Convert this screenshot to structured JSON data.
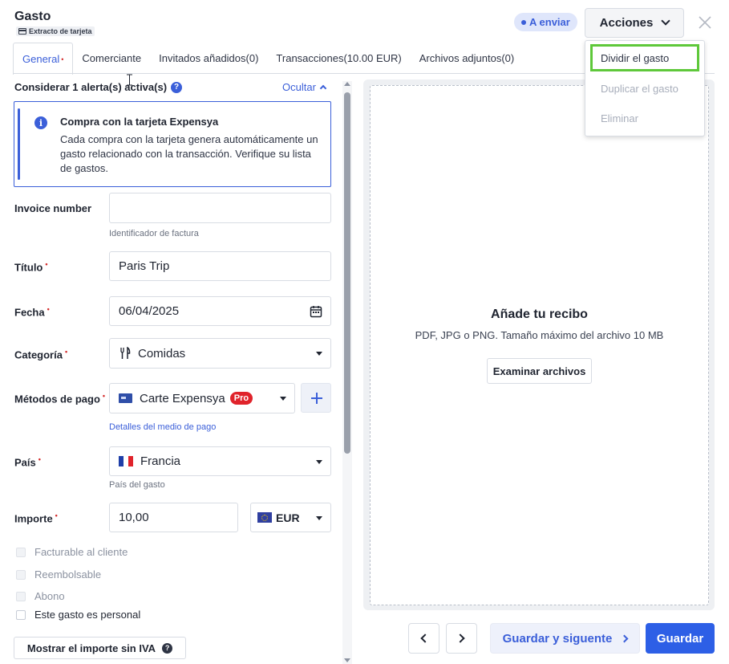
{
  "header": {
    "title": "Gasto",
    "subtitle": "Extracto de tarjeta",
    "status": "A enviar",
    "actions_label": "Acciones"
  },
  "actions_menu": {
    "items": [
      {
        "label": "Dividir el gasto",
        "enabled": true
      },
      {
        "label": "Duplicar el gasto",
        "enabled": false
      },
      {
        "label": "Eliminar",
        "enabled": false
      }
    ]
  },
  "tabs": [
    {
      "label": "General",
      "required": "•",
      "active": true
    },
    {
      "label": "Comerciante"
    },
    {
      "label": "Invitados añadidos(0)"
    },
    {
      "label": "Transacciones(10.00 EUR)"
    },
    {
      "label": "Archivos adjuntos(0)"
    }
  ],
  "alerts": {
    "heading": "Considerar 1 alerta(s) activa(s)",
    "help": "?",
    "hide_label": "Ocultar",
    "box": {
      "icon": "i",
      "title": "Compra con la tarjeta Expensya",
      "text": "Cada compra con la tarjeta genera automáticamente un gasto relacionado con la transacción. Verifique su lista de gastos."
    }
  },
  "form": {
    "required_marker": "•",
    "invoice": {
      "label": "Invoice number",
      "value": "",
      "hint": "Identificador de factura"
    },
    "title": {
      "label": "Título",
      "value": "Paris Trip"
    },
    "date": {
      "label": "Fecha",
      "value": "06/04/2025"
    },
    "category": {
      "label": "Categoría",
      "value": "Comidas",
      "icon": "cutlery-icon"
    },
    "payment": {
      "label": "Métodos de pago",
      "value": "Carte Expensya",
      "badge": "Pro",
      "link": "Detalles del medio de pago"
    },
    "country": {
      "label": "País",
      "value": "Francia",
      "hint": "País del gasto"
    },
    "amount": {
      "label": "Importe",
      "value": "10,00",
      "currency": "EUR"
    },
    "checkboxes": [
      {
        "label": "Facturable al cliente",
        "enabled": false,
        "checked": false
      },
      {
        "label": "Reembolsable",
        "enabled": false,
        "checked": false
      },
      {
        "label": "Abono",
        "enabled": false,
        "checked": false
      },
      {
        "label": "Este gasto es personal",
        "enabled": true,
        "checked": false
      }
    ],
    "vat_button": "Mostrar el importe sin IVA",
    "vat_help": "?"
  },
  "receipt": {
    "title": "Añade tu recibo",
    "subtitle": "PDF, JPG o PNG. Tamaño máximo del archivo 10 MB",
    "browse_label": "Examinar archivos"
  },
  "footer": {
    "save_next_label": "Guardar y siguente",
    "save_label": "Guardar"
  },
  "colors": {
    "accent": "#2d5fe6",
    "link": "#3b5fd9",
    "required": "#d42a2a",
    "highlight": "#5ec83a",
    "pro_badge": "#e0232b"
  }
}
